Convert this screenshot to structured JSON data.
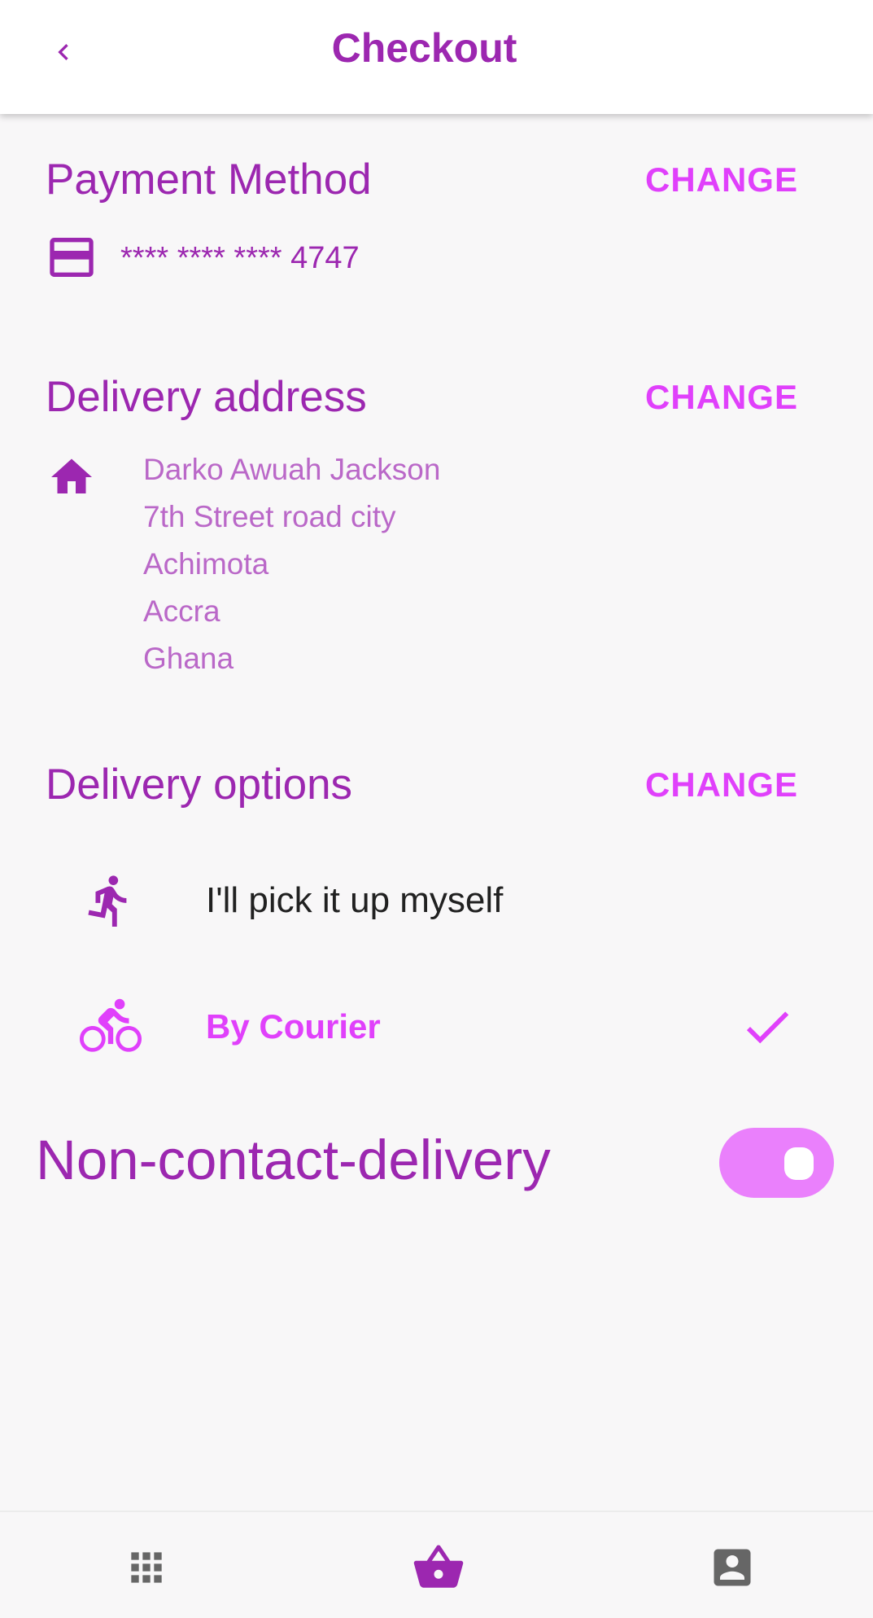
{
  "header": {
    "title": "Checkout"
  },
  "payment": {
    "title": "Payment Method",
    "change_label": "CHANGE",
    "card_number": "**** **** **** 4747"
  },
  "address": {
    "title": "Delivery address",
    "change_label": "CHANGE",
    "lines": [
      "Darko Awuah Jackson",
      "7th Street road city",
      "Achimota",
      "Accra",
      "Ghana"
    ]
  },
  "delivery_options": {
    "title": "Delivery options",
    "change_label": "CHANGE",
    "options": [
      {
        "label": "I'll pick it up myself",
        "icon": "running-person-icon",
        "selected": false
      },
      {
        "label": "By Courier",
        "icon": "bicycle-icon",
        "selected": true
      }
    ]
  },
  "non_contact": {
    "label": "Non-contact-delivery",
    "enabled": true
  },
  "bottom_nav": {
    "items": [
      {
        "icon": "grid-apps-icon",
        "active": false
      },
      {
        "icon": "shopping-basket-icon",
        "active": true
      },
      {
        "icon": "account-box-icon",
        "active": false
      }
    ]
  },
  "colors": {
    "primary": "#9c27b0",
    "accent": "#e040fb",
    "light_text": "#ba68c8",
    "toggle_track": "#ea80fc",
    "inactive_nav": "#666666"
  }
}
